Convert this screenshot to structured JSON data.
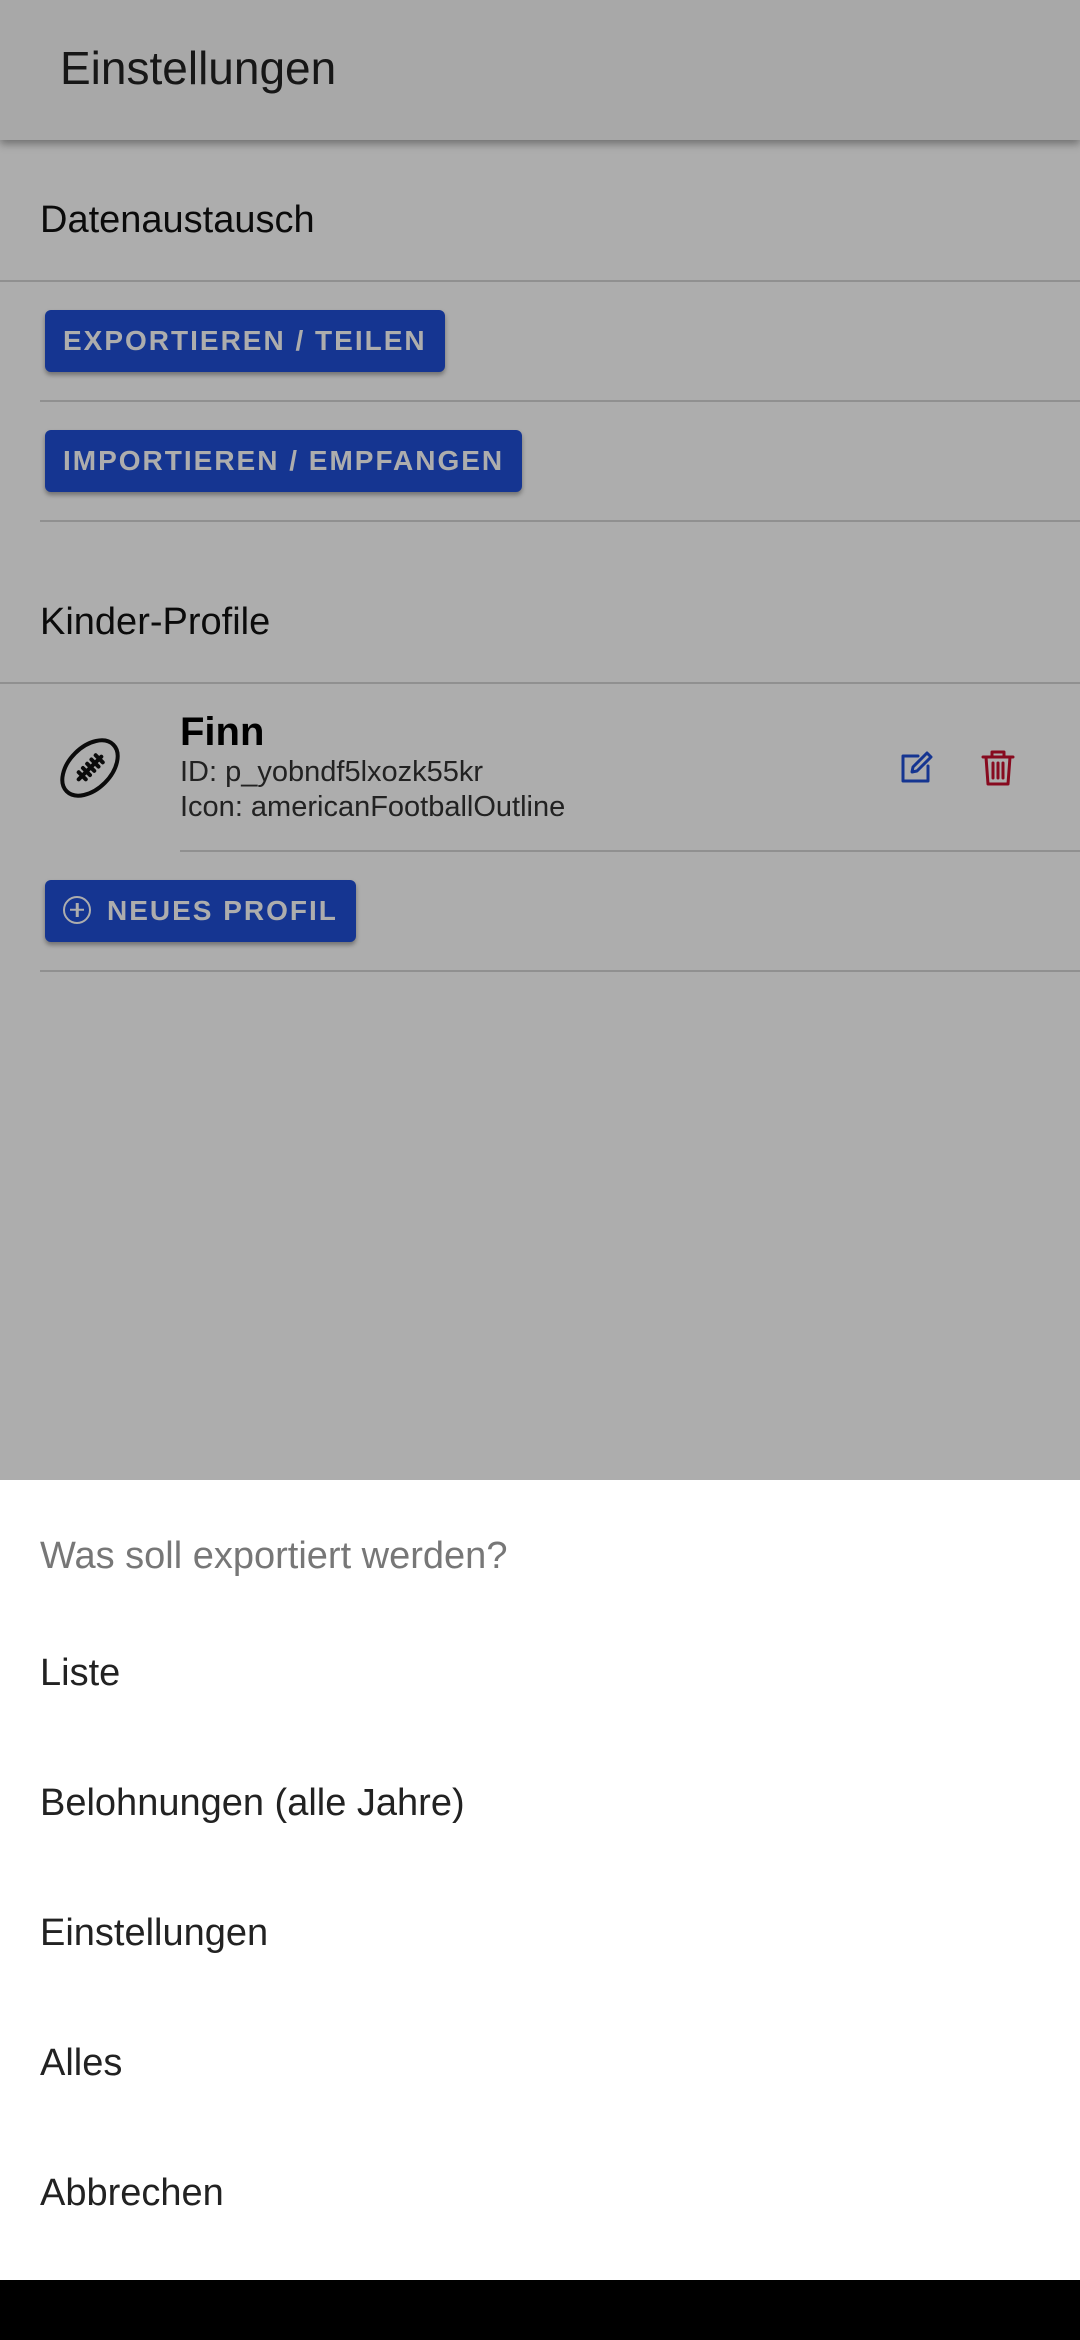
{
  "toolbar": {
    "title": "Einstellungen"
  },
  "sections": {
    "data_exchange": {
      "header": "Datenaustausch",
      "export_button": "EXPORTIEREN / TEILEN",
      "import_button": "IMPORTIEREN / EMPFANGEN"
    },
    "profiles": {
      "header": "Kinder-Profile",
      "items": [
        {
          "name": "Finn",
          "id_line": "ID: p_yobndf5lxozk55kr",
          "icon_line": "Icon: americanFootballOutline",
          "icon": "american-football-icon"
        }
      ],
      "new_profile_button": "NEUES PROFIL"
    }
  },
  "action_sheet": {
    "title": "Was soll exportiert werden?",
    "options": [
      "Liste",
      "Belohnungen (alle Jahre)",
      "Einstellungen",
      "Alles",
      "Abbrechen"
    ]
  },
  "colors": {
    "accent": "#1f4fd6",
    "edit": "#1f4fd6",
    "delete": "#c8102e"
  }
}
